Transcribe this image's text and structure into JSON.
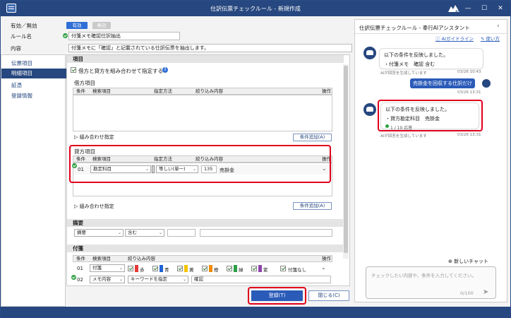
{
  "titlebar": {
    "title": "仕訳伝票チェックルール - 新規作成",
    "controls": [
      "—",
      "☐",
      "✕"
    ]
  },
  "header": {
    "active_label": "有効／無効",
    "active_on": "有効",
    "active_off": "無効",
    "rule_name_label": "ルール名",
    "rule_name_value": "付箋メモ確認仕訳抽出",
    "content_label": "内容",
    "content_value": "付箋メモに「確認」と記載されている仕訳伝票を抽出します。"
  },
  "nav": {
    "items": [
      "伝票項目",
      "明細項目",
      "証憑",
      "登録情報"
    ]
  },
  "main": {
    "item_header": "項目",
    "combine_label": "借方と貸方を組み合わせて指定する",
    "debit_title": "借方項目",
    "columns": {
      "cond": "条件",
      "item": "検索項目",
      "method": "指定方法",
      "filter": "絞り込み内容",
      "op": "操作"
    },
    "combo_label": "組み合わせ指定",
    "add_cond": "条件追加(A)",
    "credit_title": "貸方項目",
    "credit_row": {
      "no": "01",
      "item": "勘定科目",
      "method": "等しい(単一)",
      "code": "135",
      "name": "売掛金"
    },
    "summary_title": "摘要",
    "summary_row": {
      "item": "摘要",
      "method": "含む"
    },
    "fusen_title": "付箋",
    "fusen_columns": {
      "cond": "条件",
      "item": "検索項目",
      "filter": "絞り込み内容",
      "op": "操作"
    },
    "fusen_row1": {
      "no": "01",
      "item": "付箋",
      "colors": [
        "赤",
        "青",
        "黄",
        "橙",
        "緑",
        "紫"
      ],
      "none": "付箋なし"
    },
    "fusen_row2": {
      "no": "02",
      "item": "メモ内容",
      "method": "キーワードを指定",
      "value": "確認"
    }
  },
  "footer": {
    "register": "登録(T)",
    "close": "閉じる(C)"
  },
  "ai": {
    "title": "仕訳伝票チェックルール - 奉行AIアシスタント",
    "guide": "AIガイドライン",
    "howto": "使い方",
    "msg1": {
      "line1": "以下の条件を反映しました。",
      "line2": "・付箋メモ　確認 含む",
      "meta": "AIが回答を生成しています",
      "time": "03/26 10:43"
    },
    "user_msg": {
      "text": "売掛金を回収する仕訳だけ",
      "time": "03/26 13:31"
    },
    "msg2": {
      "line1": "以下の条件を反映しました。",
      "line2": "・貸方勘定科目　売掛金",
      "count": "1 / 10 応答",
      "meta": "AIが回答を生成しています",
      "time": "03/26 13:31"
    },
    "new_chat": "新しいチャット",
    "input_placeholder": "チェックしたい内容や、条件を入力してください。",
    "counter": "0/100"
  },
  "colors": {
    "brand": "#26477f",
    "highlight": "#e0001b",
    "active_pill": "#2f6fd6",
    "fusen": [
      "#e53935",
      "#1e63d6",
      "#f5c400",
      "#f08a00",
      "#2e9e47",
      "#8e44ad"
    ]
  }
}
